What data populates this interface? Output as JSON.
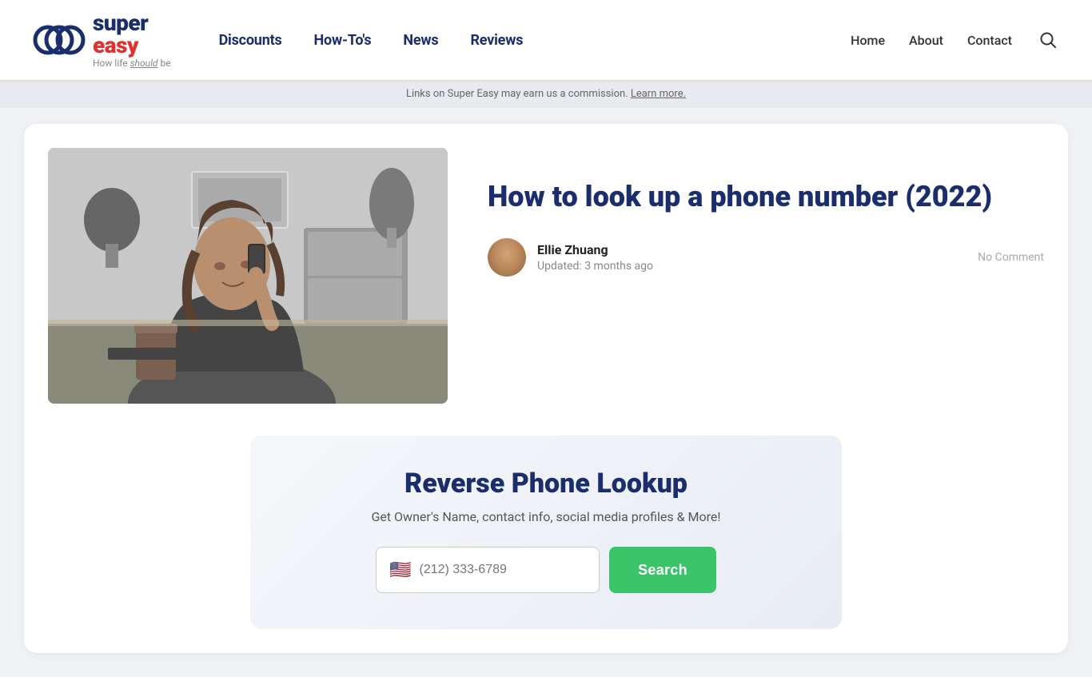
{
  "header": {
    "logo": {
      "super": "super",
      "easy": "easy",
      "tagline_prefix": "How life ",
      "tagline_emphasis": "should",
      "tagline_suffix": " be"
    },
    "nav": {
      "items": [
        {
          "label": "Discounts",
          "href": "#"
        },
        {
          "label": "How-To's",
          "href": "#"
        },
        {
          "label": "News",
          "href": "#"
        },
        {
          "label": "Reviews",
          "href": "#"
        }
      ]
    },
    "right_nav": {
      "items": [
        {
          "label": "Home",
          "href": "#"
        },
        {
          "label": "About",
          "href": "#"
        },
        {
          "label": "Contact",
          "href": "#"
        }
      ]
    }
  },
  "affiliate": {
    "text": "Links on Super Easy may earn us a commission. Learn more."
  },
  "article": {
    "title": "How to look up a phone number (2022)",
    "author": {
      "name": "Ellie Zhuang",
      "updated": "Updated: 3 months ago"
    },
    "no_comment": "No Comment"
  },
  "widget": {
    "title": "Reverse Phone Lookup",
    "subtitle": "Get Owner's Name, contact info, social media profiles & More!",
    "input_placeholder": "(212) 333-6789",
    "search_label": "Search",
    "flag": "🇺🇸"
  }
}
